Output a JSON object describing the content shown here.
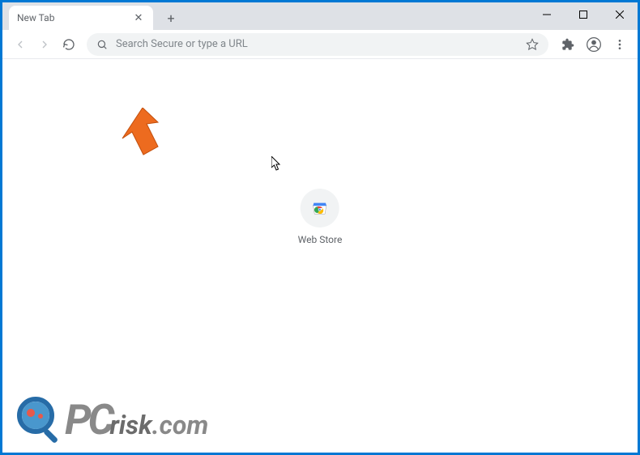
{
  "tab": {
    "title": "New Tab"
  },
  "omnibox": {
    "placeholder": "Search Secure or type a URL"
  },
  "shortcut": {
    "label": "Web Store"
  },
  "watermark": {
    "pc": "PC",
    "risk": "risk",
    "com": ".com"
  }
}
